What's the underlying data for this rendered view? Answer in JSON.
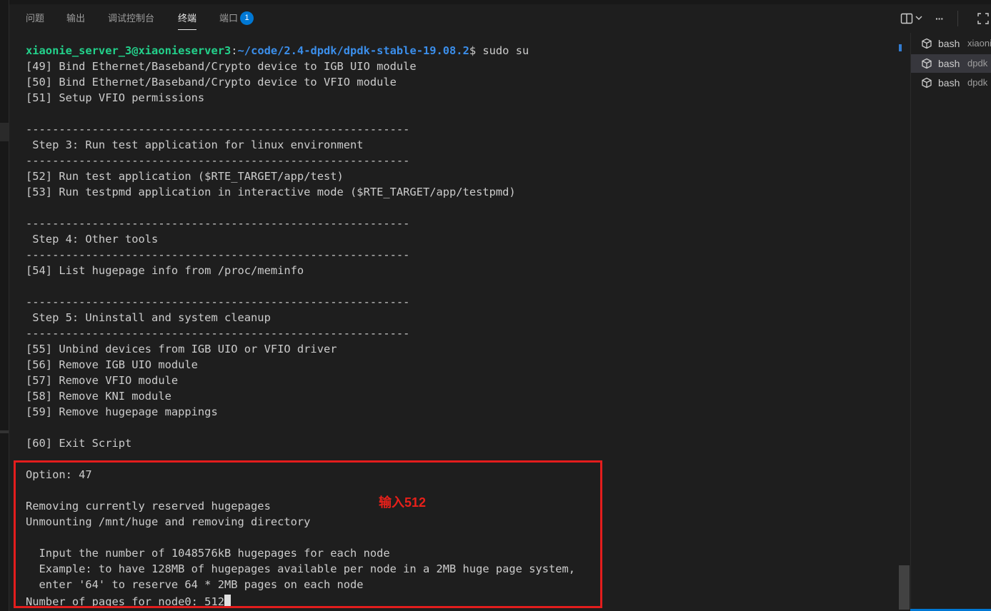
{
  "panel": {
    "tabs": [
      {
        "label": "问题"
      },
      {
        "label": "输出"
      },
      {
        "label": "调试控制台"
      },
      {
        "label": "终端",
        "active": true
      },
      {
        "label": "端口",
        "badge": "1"
      }
    ],
    "actions": {
      "split_icon": "split-terminal-icon",
      "dropdown_icon": "chevron-down-icon",
      "more_label": "···",
      "maximize_icon": "maximize-panel-icon"
    }
  },
  "terminal": {
    "prompt": {
      "user": "xiaonie_server_3@xiaonieserver3",
      "sep": ":",
      "path": "~/code/2.4-dpdk/dpdk-stable-19.08.2",
      "suffix": "$ sudo su"
    },
    "lines": [
      "[49] Bind Ethernet/Baseband/Crypto device to IGB UIO module",
      "[50] Bind Ethernet/Baseband/Crypto device to VFIO module",
      "[51] Setup VFIO permissions",
      "",
      "----------------------------------------------------------",
      " Step 3: Run test application for linux environment",
      "----------------------------------------------------------",
      "[52] Run test application ($RTE_TARGET/app/test)",
      "[53] Run testpmd application in interactive mode ($RTE_TARGET/app/testpmd)",
      "",
      "----------------------------------------------------------",
      " Step 4: Other tools",
      "----------------------------------------------------------",
      "[54] List hugepage info from /proc/meminfo",
      "",
      "----------------------------------------------------------",
      " Step 5: Uninstall and system cleanup",
      "----------------------------------------------------------",
      "[55] Unbind devices from IGB UIO or VFIO driver",
      "[56] Remove IGB UIO module",
      "[57] Remove VFIO module",
      "[58] Remove KNI module",
      "[59] Remove hugepage mappings",
      "",
      "[60] Exit Script",
      "",
      "Option: 47",
      "",
      "Removing currently reserved hugepages",
      "Unmounting /mnt/huge and removing directory",
      "",
      "  Input the number of 1048576kB hugepages for each node",
      "  Example: to have 128MB of hugepages available per node in a 2MB huge page system,",
      "  enter '64' to reserve 64 * 2MB pages on each node"
    ],
    "input_line": "Number of pages for node0: 512",
    "annotation": "输入512",
    "annotation_color": "#e31d1d"
  },
  "terminal_list": [
    {
      "name": "bash",
      "desc": "xiaonie...",
      "icon": "terminal-icon"
    },
    {
      "name": "bash",
      "desc": "dpdk",
      "icon": "terminal-icon",
      "active": true
    },
    {
      "name": "bash",
      "desc": "dpdk",
      "icon": "terminal-icon"
    }
  ],
  "colors": {
    "background": "#1e1e1e",
    "prompt_user": "#23d18b",
    "prompt_path": "#3b8eea",
    "accent": "#0078d4"
  }
}
